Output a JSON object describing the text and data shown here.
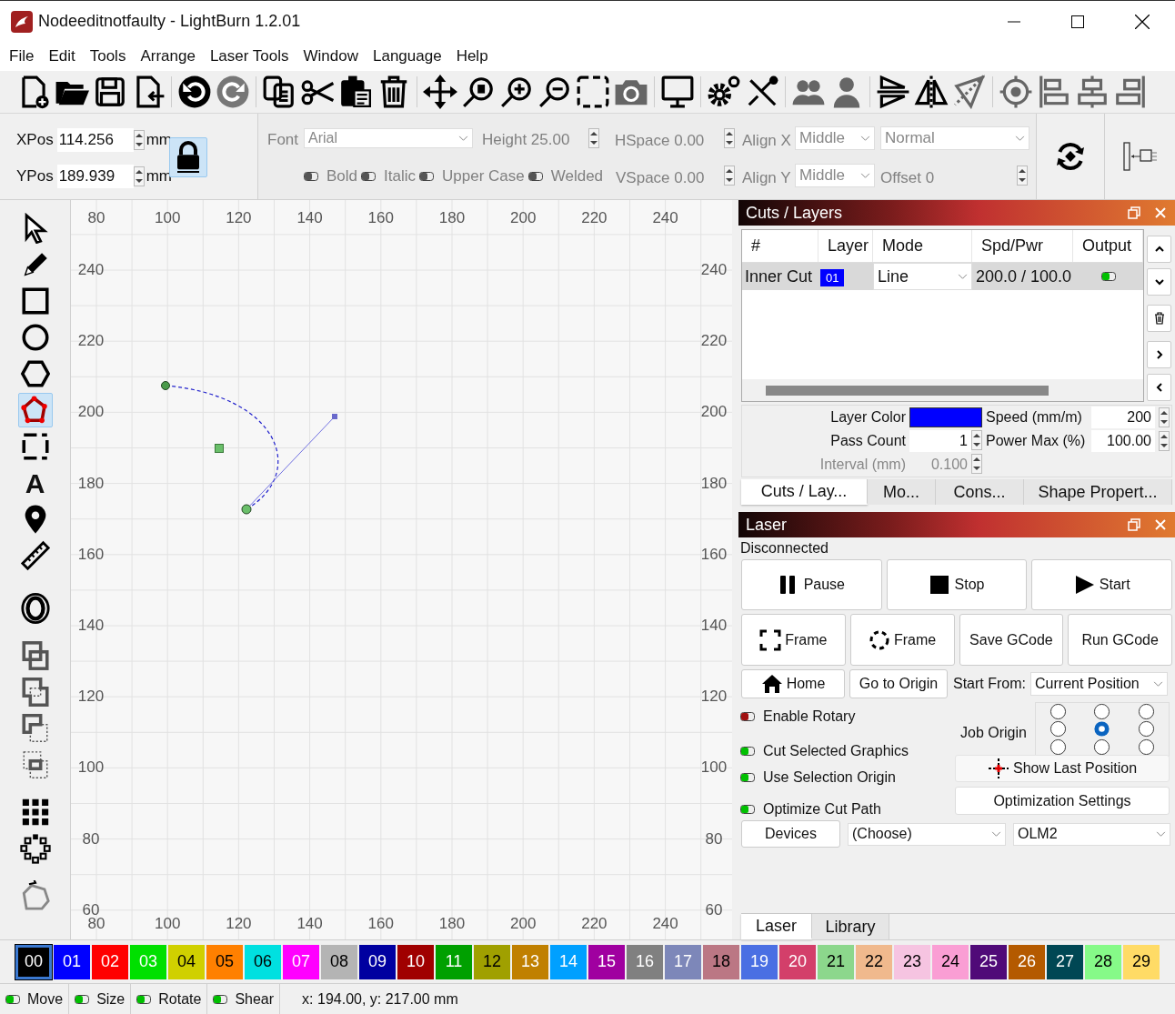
{
  "window": {
    "title": "Nodeeditnotfaulty - LightBurn 1.2.01"
  },
  "menu": [
    "File",
    "Edit",
    "Tools",
    "Arrange",
    "Laser Tools",
    "Window",
    "Language",
    "Help"
  ],
  "position": {
    "xpos_label": "XPos",
    "xpos": "114.256",
    "xpos_unit": "mm",
    "ypos_label": "YPos",
    "ypos": "189.939",
    "ypos_unit": "mm",
    "locked": true
  },
  "text_options": {
    "disabled": true,
    "font_label": "Font",
    "font": "Arial",
    "height": "Height 25.00",
    "hspace": "HSpace 0.00",
    "vspace": "VSpace 0.00",
    "align_x_label": "Align X",
    "align_x": "Middle",
    "align_y_label": "Align Y",
    "align_y": "Middle",
    "style": "Normal",
    "offset": "Offset 0",
    "toggles": [
      {
        "label": "Bold",
        "on": false
      },
      {
        "label": "Italic",
        "on": false
      },
      {
        "label": "Upper Case",
        "on": false
      },
      {
        "label": "Welded",
        "on": false
      }
    ]
  },
  "tools": [
    {
      "kind": "select",
      "selected": false
    },
    {
      "kind": "pencil",
      "selected": false
    },
    {
      "kind": "rectangle",
      "selected": false
    },
    {
      "kind": "ellipse",
      "selected": false
    },
    {
      "kind": "polygon",
      "selected": false
    },
    {
      "kind": "edit-nodes",
      "selected": true
    },
    {
      "kind": "frame",
      "selected": false
    },
    {
      "kind": "text",
      "glyph": "A",
      "selected": false
    },
    {
      "kind": "marker",
      "selected": false
    },
    {
      "kind": "ruler",
      "selected": false
    },
    {
      "kind": "offset",
      "selected": false
    },
    {
      "kind": "weld",
      "selected": false
    },
    {
      "kind": "union",
      "selected": false
    },
    {
      "kind": "subtract",
      "selected": false
    },
    {
      "kind": "intersect",
      "selected": false
    },
    {
      "kind": "grid-array",
      "selected": false
    },
    {
      "kind": "circular-array",
      "selected": false
    },
    {
      "kind": "node-path",
      "selected": false
    }
  ],
  "canvas": {
    "top_ruler": [
      "80",
      "100",
      "120",
      "140",
      "160",
      "180",
      "200",
      "220",
      "240"
    ],
    "bottom_ruler": [
      "80",
      "100",
      "120",
      "140",
      "160",
      "180",
      "200",
      "220",
      "240"
    ],
    "left_ruler": [
      "240",
      "220",
      "200",
      "180",
      "160",
      "140",
      "120",
      "100",
      "80",
      "60"
    ],
    "right_ruler": [
      "240",
      "220",
      "200",
      "180",
      "160",
      "140",
      "120",
      "100",
      "80",
      "60"
    ]
  },
  "cuts_layers": {
    "title": "Cuts / Layers",
    "columns": [
      "#",
      "Layer",
      "Mode",
      "Spd/Pwr",
      "Output"
    ],
    "rows": [
      {
        "name": "Inner Cut",
        "layer": "01",
        "color": "#0000ff",
        "mode": "Line",
        "spd_pwr": "200.0 / 100.0",
        "output": true,
        "selected": true
      }
    ],
    "layer_color": {
      "label": "Layer Color",
      "color": "#0000ff"
    },
    "pass_count_label": "Pass Count",
    "pass_count": "1",
    "interval_label": "Interval (mm)",
    "interval": "0.100",
    "speed_label": "Speed (mm/m)",
    "speed": "200",
    "power_label": "Power Max (%)",
    "power": "100.00",
    "tabs": [
      {
        "label": "Cuts / Lay...",
        "selected": true
      },
      {
        "label": "Mo...",
        "selected": false
      },
      {
        "label": "Cons...",
        "selected": false
      },
      {
        "label": "Shape Propert...",
        "selected": false
      }
    ]
  },
  "laser": {
    "title": "Laser",
    "status": "Disconnected",
    "buttons": [
      {
        "kind": "pause",
        "label": "Pause"
      },
      {
        "kind": "stop",
        "label": "Stop"
      },
      {
        "kind": "start",
        "label": "Start"
      },
      {
        "kind": "frame",
        "label": "Frame"
      },
      {
        "kind": "frame-circle",
        "label": "Frame"
      },
      {
        "kind": "plain",
        "label": "Save GCode"
      },
      {
        "kind": "plain",
        "label": "Run GCode"
      }
    ],
    "home": "Home",
    "go_to_origin": "Go to Origin",
    "start_from_label": "Start From:",
    "start_from": "Current Position",
    "toggles": [
      {
        "label": "Enable Rotary",
        "on": false
      },
      {
        "label": "Cut Selected Graphics",
        "on": true
      },
      {
        "label": "Use Selection Origin",
        "on": true
      },
      {
        "label": "Optimize Cut Path",
        "on": true
      }
    ],
    "job_origin_label": "Job Origin",
    "job_origin": [
      {
        "selected": false
      },
      {
        "selected": false
      },
      {
        "selected": false
      },
      {
        "selected": false
      },
      {
        "selected": true
      },
      {
        "selected": false
      },
      {
        "selected": false
      },
      {
        "selected": false
      },
      {
        "selected": false
      }
    ],
    "show_last_position": "Show Last Position",
    "optimization_settings": "Optimization Settings",
    "devices": "Devices",
    "device_choice": "(Choose)",
    "device": "OLM2",
    "tabs": [
      {
        "label": "Laser",
        "selected": true
      },
      {
        "label": "Library",
        "selected": false
      }
    ]
  },
  "palette": [
    {
      "label": "00",
      "color": "#000000",
      "selected": true
    },
    {
      "label": "01",
      "color": "#0000ff",
      "selected": false
    },
    {
      "label": "02",
      "color": "#ff0000",
      "selected": false
    },
    {
      "label": "03",
      "color": "#00e000",
      "selected": false
    },
    {
      "label": "04",
      "color": "#d0d000",
      "selected": false
    },
    {
      "label": "05",
      "color": "#ff8000",
      "selected": false
    },
    {
      "label": "06",
      "color": "#00e0e0",
      "selected": false
    },
    {
      "label": "07",
      "color": "#ff00ff",
      "selected": false
    },
    {
      "label": "08",
      "color": "#b4b4b4",
      "selected": false
    },
    {
      "label": "09",
      "color": "#0000a0",
      "selected": false
    },
    {
      "label": "10",
      "color": "#a00000",
      "selected": false
    },
    {
      "label": "11",
      "color": "#00a000",
      "selected": false
    },
    {
      "label": "12",
      "color": "#a0a000",
      "selected": false
    },
    {
      "label": "13",
      "color": "#c08000",
      "selected": false
    },
    {
      "label": "14",
      "color": "#00a0ff",
      "selected": false
    },
    {
      "label": "15",
      "color": "#a000a0",
      "selected": false
    },
    {
      "label": "16",
      "color": "#808080",
      "selected": false
    },
    {
      "label": "17",
      "color": "#7d87b9",
      "selected": false
    },
    {
      "label": "18",
      "color": "#bb7784",
      "selected": false
    },
    {
      "label": "19",
      "color": "#4a6fe3",
      "selected": false
    },
    {
      "label": "20",
      "color": "#d33f6a",
      "selected": false
    },
    {
      "label": "21",
      "color": "#8cd78c",
      "selected": false
    },
    {
      "label": "22",
      "color": "#f0b98d",
      "selected": false
    },
    {
      "label": "23",
      "color": "#f6c4e1",
      "selected": false
    },
    {
      "label": "24",
      "color": "#fa9ed4",
      "selected": false
    },
    {
      "label": "25",
      "color": "#500a78",
      "selected": false
    },
    {
      "label": "26",
      "color": "#b45a00",
      "selected": false
    },
    {
      "label": "27",
      "color": "#004754",
      "selected": false
    },
    {
      "label": "28",
      "color": "#86fa88",
      "selected": false
    },
    {
      "label": "29",
      "color": "#ffdb66",
      "selected": false
    }
  ],
  "status_bar": {
    "toggles": [
      {
        "label": "Move",
        "on": true
      },
      {
        "label": "Size",
        "on": true
      },
      {
        "label": "Rotate",
        "on": true
      },
      {
        "label": "Shear",
        "on": true
      }
    ],
    "coords": "x: 194.00, y: 217.00 mm"
  }
}
